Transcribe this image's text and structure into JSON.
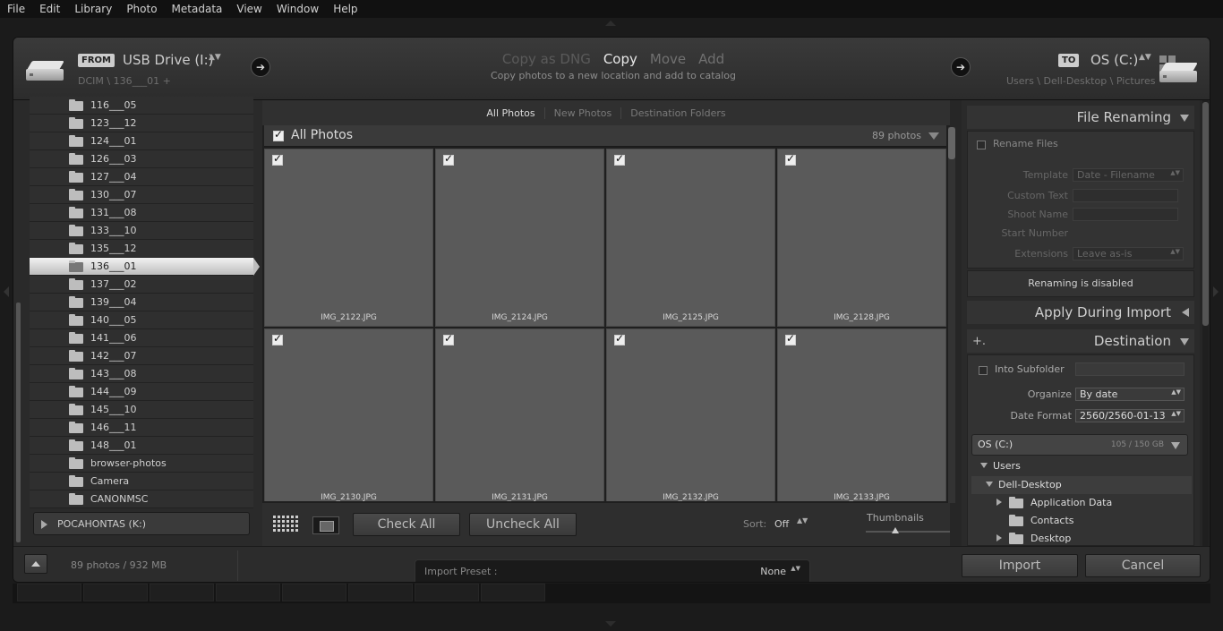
{
  "menubar": [
    "File",
    "Edit",
    "Library",
    "Photo",
    "Metadata",
    "View",
    "Window",
    "Help"
  ],
  "header": {
    "from_tag": "FROM",
    "from_drive": "USB Drive (I:)",
    "from_path": "DCIM \\ 136___01 +",
    "modes": [
      "Copy as DNG",
      "Copy",
      "Move",
      "Add"
    ],
    "active_mode": "Copy",
    "mode_desc": "Copy photos to a new location and add to catalog",
    "to_tag": "TO",
    "to_drive": "OS (C:)",
    "to_path": "Users \\ Dell-Desktop \\ Pictures",
    "updown": "▲▼",
    "arrow_glyph": "➔"
  },
  "source": {
    "folders": [
      "116___05",
      "123___12",
      "124___01",
      "126___03",
      "127___04",
      "130___07",
      "131___08",
      "133___10",
      "135___12",
      "136___01",
      "137___02",
      "139___04",
      "140___05",
      "141___06",
      "142___07",
      "143___08",
      "144___09",
      "145___10",
      "146___11",
      "148___01",
      "browser-photos",
      "Camera",
      "CANONMSC"
    ],
    "selected_folder": "136___01",
    "other_drive": "POCAHONTAS (K:)"
  },
  "center": {
    "view_tabs": [
      "All Photos",
      "New Photos",
      "Destination Folders"
    ],
    "active_tab": "All Photos",
    "grid_title": "All Photos",
    "photo_count": "89 photos",
    "photos": [
      "IMG_2122.JPG",
      "IMG_2124.JPG",
      "IMG_2125.JPG",
      "IMG_2128.JPG",
      "IMG_2130.JPG",
      "IMG_2131.JPG",
      "IMG_2132.JPG",
      "IMG_2133.JPG"
    ],
    "check_all": "Check All",
    "uncheck_all": "Uncheck All",
    "sort_label": "Sort:",
    "sort_value": "Off",
    "thumbnails_label": "Thumbnails",
    "thumbnail_size_fraction": 0.35
  },
  "right": {
    "file_renaming": {
      "title": "File Renaming",
      "rename_files": "Rename Files",
      "template_label": "Template",
      "template_value": "Date - Filename",
      "custom_text_label": "Custom Text",
      "shoot_name_label": "Shoot Name",
      "start_number_label": "Start Number",
      "extensions_label": "Extensions",
      "extensions_value": "Leave as-is",
      "disabled_msg": "Renaming is disabled"
    },
    "apply_during_import": "Apply During Import",
    "destination": {
      "plus": "+.",
      "title": "Destination",
      "into_subfolder": "Into Subfolder",
      "organize_label": "Organize",
      "organize_value": "By date",
      "date_format_label": "Date Format",
      "date_format_value": "2560/2560-01-13",
      "drive_name": "OS (C:)",
      "drive_space": "105 / 150 GB",
      "tree": [
        "Users",
        "Dell-Desktop",
        "Application Data",
        "Contacts",
        "Desktop"
      ]
    }
  },
  "footer": {
    "summary": "89 photos / 932 MB",
    "preset_label": "Import Preset :",
    "preset_value": "None",
    "import": "Import",
    "cancel": "Cancel"
  }
}
